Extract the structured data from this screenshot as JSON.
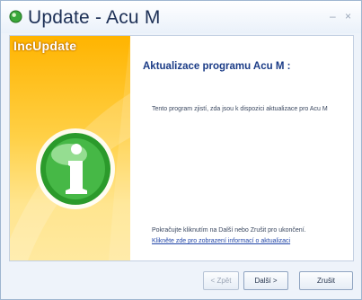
{
  "window": {
    "title": "Update - Acu M",
    "minimize_glyph": "–",
    "close_glyph": "×"
  },
  "banner": {
    "brand": "IncUpdate",
    "icon": "info-icon"
  },
  "content": {
    "heading": "Aktualizace programu Acu M :",
    "description": "Tento program zjistí, zda jsou k dispozici aktualizace pro Acu M",
    "hint": "Pokračujte kliknutím na Další nebo Zrušit pro ukončení.",
    "link": "Klikněte zde pro zobrazení informací o aktualizaci"
  },
  "buttons": {
    "back": "< Zpět",
    "next": "Další >",
    "cancel": "Zrušit"
  },
  "colors": {
    "accent": "#1a3b86",
    "banner_top": "#ffb400",
    "banner_bottom": "#ffe99f",
    "icon_green": "#2b9a2b"
  }
}
